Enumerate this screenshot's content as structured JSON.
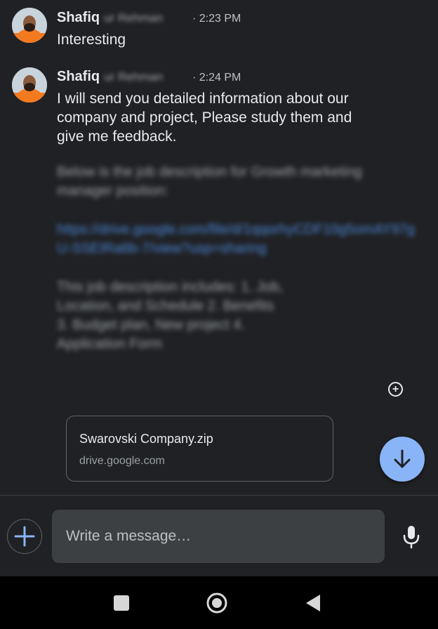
{
  "messages": [
    {
      "sender_first": "Shafiq",
      "sender_last": "ur Rehman",
      "time": "· 2:23 PM",
      "text": "Interesting"
    },
    {
      "sender_first": "Shafiq",
      "sender_last": "ur Rehman",
      "time": "· 2:24 PM",
      "text_lines": [
        "I will send you detailed information about our",
        "company and project, Please study them and",
        "give me feedback."
      ],
      "blurred_paragraphs": [
        "Below is the job description for Growth marketing manager position:",
        "https://drive.google.com/file/d/1qqorhyCDF10g5omAY97gU-SSEIRa6b-7/view?usp=sharing",
        "This job description includes: 1. Job, Location, and Schedule 2. Benefits 3. Budget plan, New project 4. Application Form"
      ]
    }
  ],
  "attachment": {
    "filename": "Swarovski Company.zip",
    "domain": "drive.google.com"
  },
  "compose": {
    "placeholder": "Write a message…"
  },
  "icons": {
    "add_reaction": "add-reaction-icon",
    "scroll_down": "arrow-down-icon",
    "add": "plus-icon",
    "mic": "microphone-icon",
    "nav_recent": "square-icon",
    "nav_home": "circle-icon",
    "nav_back": "triangle-back-icon"
  },
  "colors": {
    "background": "#202124",
    "accent": "#8ab4f8",
    "input_bg": "#3c4043",
    "nav_bg": "#000000"
  }
}
